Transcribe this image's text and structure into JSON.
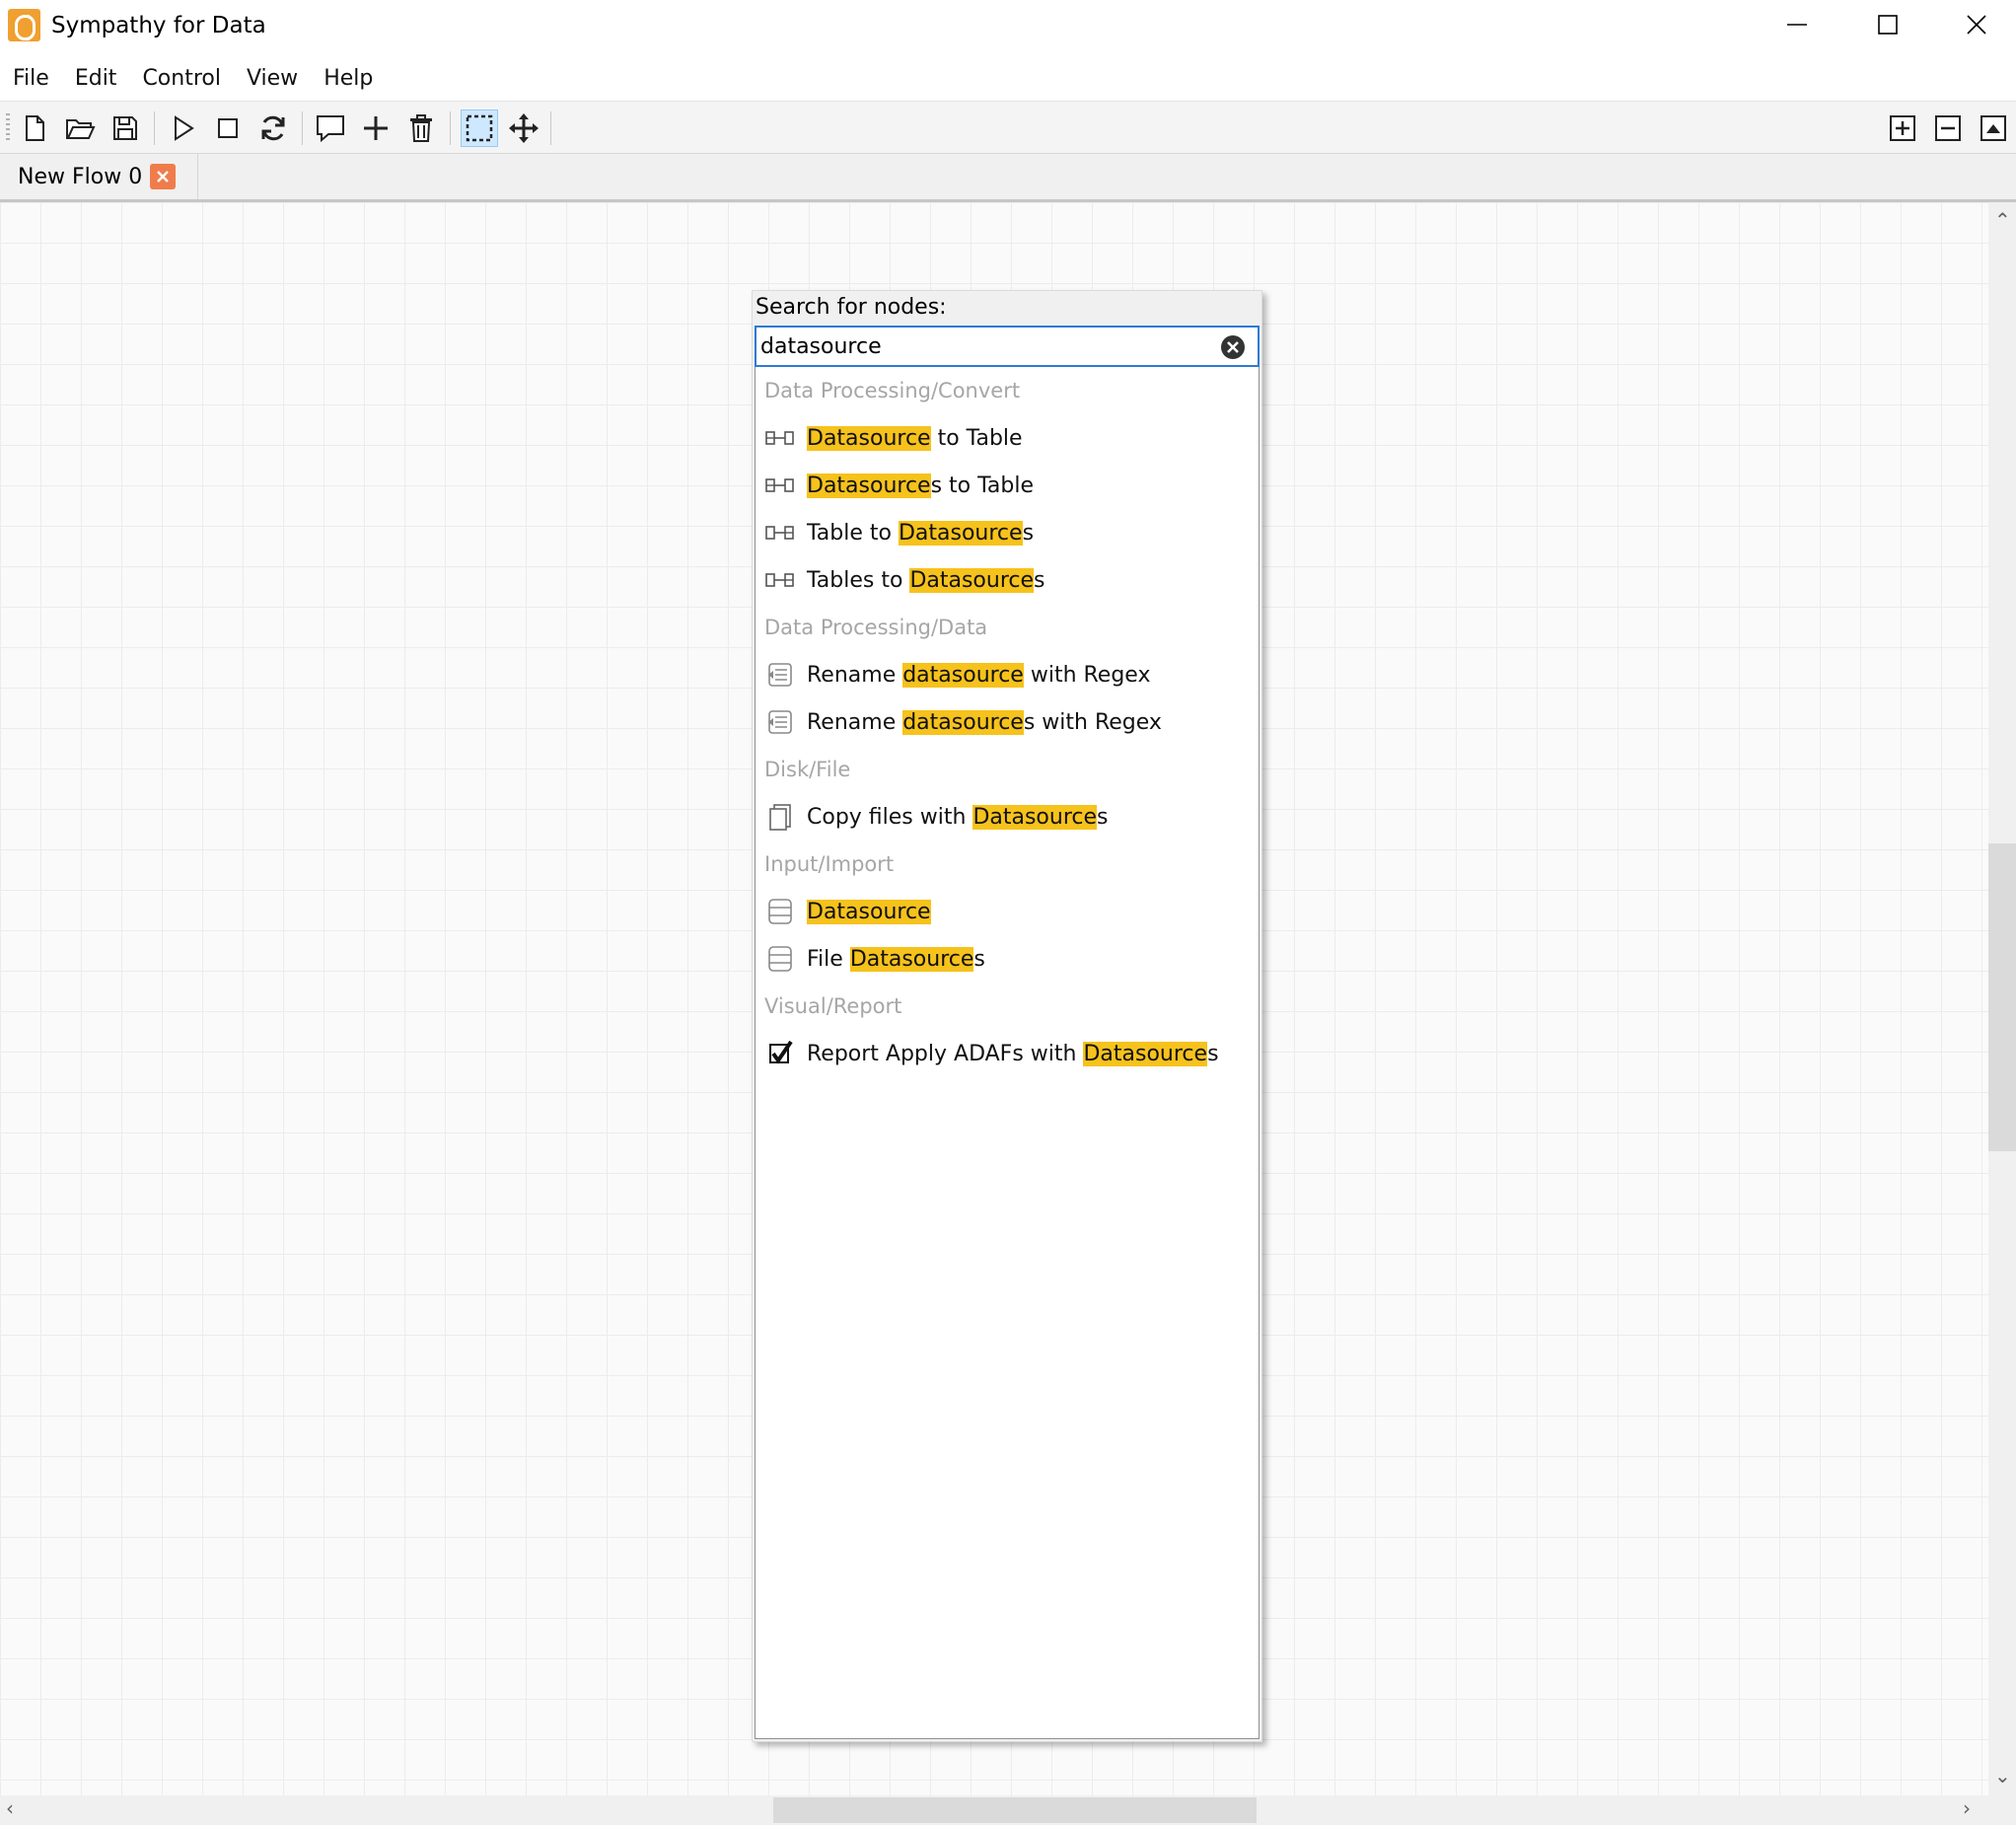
{
  "window": {
    "title": "Sympathy for Data"
  },
  "menu": [
    "File",
    "Edit",
    "Control",
    "View",
    "Help"
  ],
  "toolbar": {
    "left": [
      "new-file-icon",
      "open-folder-icon",
      "save-icon",
      "play-icon",
      "stop-icon",
      "reload-icon",
      "comment-icon",
      "insert-node-icon",
      "delete-icon",
      "select-rect-icon",
      "move-icon"
    ],
    "right": [
      "zoom-in-icon",
      "zoom-out-icon",
      "zoom-fit-icon"
    ]
  },
  "tabs": [
    {
      "label": "New Flow 0"
    }
  ],
  "search": {
    "label": "Search for nodes:",
    "value": "datasource",
    "results": [
      {
        "kind": "category",
        "text": "Data Processing/Convert"
      },
      {
        "kind": "item",
        "icon": "convert-icon",
        "parts": [
          {
            "t": "Datasource",
            "h": true
          },
          {
            "t": " to Table",
            "h": false
          }
        ]
      },
      {
        "kind": "item",
        "icon": "convert-icon",
        "parts": [
          {
            "t": "Datasource",
            "h": true
          },
          {
            "t": "s to Table",
            "h": false
          }
        ]
      },
      {
        "kind": "item",
        "icon": "convert-reverse-icon",
        "parts": [
          {
            "t": "Table to ",
            "h": false
          },
          {
            "t": "Datasource",
            "h": true
          },
          {
            "t": "s",
            "h": false
          }
        ]
      },
      {
        "kind": "item",
        "icon": "convert-reverse-icon",
        "parts": [
          {
            "t": "Tables to ",
            "h": false
          },
          {
            "t": "Datasource",
            "h": true
          },
          {
            "t": "s",
            "h": false
          }
        ]
      },
      {
        "kind": "category",
        "text": "Data Processing/Data"
      },
      {
        "kind": "item",
        "icon": "rename-icon",
        "parts": [
          {
            "t": "Rename ",
            "h": false
          },
          {
            "t": "datasource",
            "h": true
          },
          {
            "t": " with Regex",
            "h": false
          }
        ]
      },
      {
        "kind": "item",
        "icon": "rename-icon",
        "parts": [
          {
            "t": "Rename ",
            "h": false
          },
          {
            "t": "datasource",
            "h": true
          },
          {
            "t": "s with Regex",
            "h": false
          }
        ]
      },
      {
        "kind": "category",
        "text": "Disk/File"
      },
      {
        "kind": "item",
        "icon": "copy-files-icon",
        "parts": [
          {
            "t": "Copy files with ",
            "h": false
          },
          {
            "t": "Datasource",
            "h": true
          },
          {
            "t": "s",
            "h": false
          }
        ]
      },
      {
        "kind": "category",
        "text": "Input/Import"
      },
      {
        "kind": "item",
        "icon": "database-icon",
        "parts": [
          {
            "t": "Datasource",
            "h": true
          }
        ]
      },
      {
        "kind": "item",
        "icon": "database-icon",
        "parts": [
          {
            "t": "File ",
            "h": false
          },
          {
            "t": "Datasource",
            "h": true
          },
          {
            "t": "s",
            "h": false
          }
        ]
      },
      {
        "kind": "category",
        "text": "Visual/Report"
      },
      {
        "kind": "item",
        "icon": "checkmark-icon",
        "parts": [
          {
            "t": "Report Apply ADAFs with ",
            "h": false
          },
          {
            "t": "Datasource",
            "h": true
          },
          {
            "t": "s",
            "h": false
          }
        ]
      }
    ]
  },
  "colors": {
    "highlight": "#f6c21c",
    "tab_close": "#f07c4c",
    "focus_border": "#2c7bd5",
    "logo": "#f0a030"
  }
}
